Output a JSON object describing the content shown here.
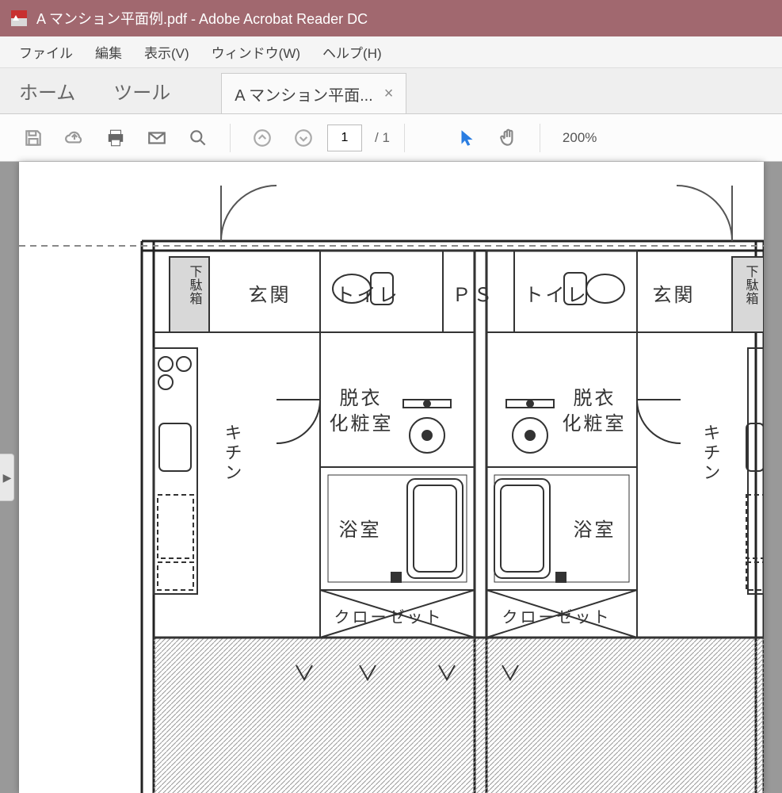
{
  "titlebar": {
    "title": "A マンション平面例.pdf - Adobe Acrobat Reader DC"
  },
  "menu": {
    "file": "ファイル",
    "edit": "編集",
    "view": "表示(V)",
    "window": "ウィンドウ(W)",
    "help": "ヘルプ(H)"
  },
  "tabs": {
    "home": "ホーム",
    "tools": "ツール",
    "doc_title": "A マンション平面...",
    "close": "×"
  },
  "toolbar": {
    "page_current": "1",
    "page_total": "/ 1",
    "zoom": "200%"
  },
  "floorplan": {
    "genkan_left": "玄関",
    "genkan_right": "玄関",
    "getabako_left": "下駄箱",
    "getabako_right": "下駄箱",
    "toilet_left": "トイレ",
    "toilet_right": "トイレ",
    "ps": "ＰＳ",
    "datsui_left_1": "脱衣",
    "datsui_left_2": "化粧室",
    "datsui_right_1": "脱衣",
    "datsui_right_2": "化粧室",
    "yokushitsu_left": "浴室",
    "yokushitsu_right": "浴室",
    "kitchen_left": "キチン",
    "kitchen_right": "キチン",
    "closet_left": "クローゼット",
    "closet_right": "クローゼット"
  }
}
